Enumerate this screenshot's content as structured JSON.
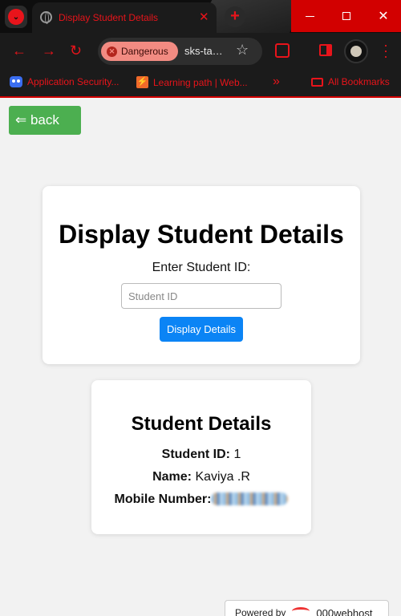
{
  "browser": {
    "tab_title": "Display Student Details",
    "new_tab_symbol": "+",
    "tab_close_symbol": "✕",
    "security_chip": "Dangerous",
    "url": "sks-ta…",
    "bookmarks": [
      {
        "label": "Application Security..."
      },
      {
        "label": "Learning path | Web..."
      }
    ],
    "bookmarks_more": "»",
    "all_bookmarks": "All Bookmarks",
    "accent_color": "#e8141b"
  },
  "page": {
    "back_label": "⇐ back",
    "form": {
      "title": "Display Student Details",
      "label": "Enter Student ID:",
      "placeholder": "Student ID",
      "value": "",
      "button": "Display Details"
    },
    "details": {
      "title": "Student Details",
      "id_label": "Student ID:",
      "id_value": "1",
      "name_label": "Name:",
      "name_value": "Kaviya .R",
      "mobile_label": "Mobile Number:"
    },
    "powered_by": "Powered by",
    "host_brand": "000webhost"
  }
}
